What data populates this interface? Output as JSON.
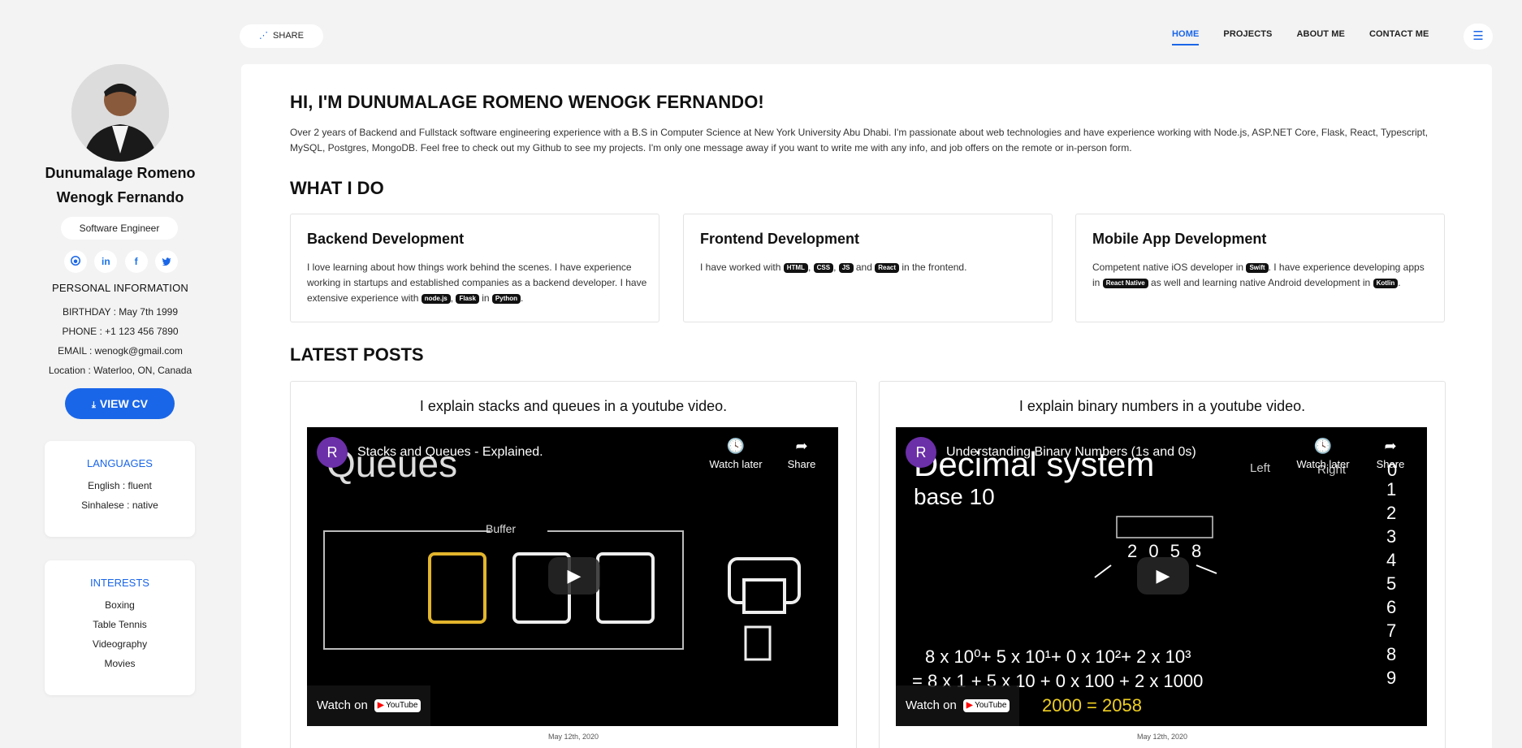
{
  "profile": {
    "name": "Dunumalage Romeno Wenogk Fernando",
    "role": "Software Engineer",
    "socials": [
      "github-icon",
      "linkedin-icon",
      "facebook-icon",
      "twitter-icon"
    ],
    "personal_title": "PERSONAL INFORMATION",
    "birthday": "BIRTHDAY : May 7th 1999",
    "phone": "PHONE : +1 123 456 7890",
    "email": "EMAIL : wenogk@gmail.com",
    "location": "Location : Waterloo, ON, Canada",
    "cv_label": "VIEW CV"
  },
  "languages": {
    "title": "LANGUAGES",
    "items": [
      "English : fluent",
      "Sinhalese : native"
    ]
  },
  "interests": {
    "title": "INTERESTS",
    "items": [
      "Boxing",
      "Table Tennis",
      "Videography",
      "Movies"
    ]
  },
  "topbar": {
    "share": "SHARE",
    "nav": [
      "HOME",
      "PROJECTS",
      "ABOUT ME",
      "CONTACT ME"
    ],
    "active": "HOME"
  },
  "hero": {
    "title": "HI, I'M DUNUMALAGE ROMENO WENOGK FERNANDO!",
    "text": "Over 2 years of Backend and Fullstack software engineering experience with a B.S in Computer Science at New York University Abu Dhabi. I'm passionate about web technologies and have experience working with Node.js, ASP.NET Core, Flask, React, Typescript, MySQL, Postgres, MongoDB. Feel free to check out my Github to see my projects. I'm only one message away if you want to write me with any info, and job offers on the remote or in-person form."
  },
  "what_i_do": {
    "title": "WHAT I DO",
    "services": [
      {
        "title": "Backend Development"
      },
      {
        "title": "Frontend Development"
      },
      {
        "title": "Mobile App Development"
      }
    ],
    "backend": {
      "t1": "I love learning about how things work behind the scenes. I have experience working in startups and established companies as a backend developer. I have extensive experience with ",
      "tags": [
        "node.js",
        "Flask",
        "Python"
      ],
      "sep": ", ",
      "in": " in ",
      "end": "."
    },
    "frontend": {
      "t1": "I have worked with ",
      "tags": [
        "HTML",
        "CSS",
        "JS",
        "React"
      ],
      "sep": ", ",
      "and": " and ",
      "end": " in the frontend."
    },
    "mobile": {
      "t1": "Competent native iOS developer in ",
      "t2": ". I have experience developing apps in ",
      "t3": " as well and learning native Android development in ",
      "tags": [
        "Swift",
        "React Native",
        "Kotlin"
      ],
      "end": "."
    }
  },
  "posts": {
    "title": "LATEST POSTS",
    "items": [
      {
        "heading": "I explain stacks and queues in a youtube video.",
        "video_title": "Stacks and Queues - Explained.",
        "channel_initial": "R",
        "date": "May 12th, 2020",
        "overlay_big": "Queues",
        "overlay_label": "Buffer"
      },
      {
        "heading": "I explain binary numbers in a youtube video.",
        "video_title": "Understanding Binary Numbers (1s and 0s)",
        "channel_initial": "R",
        "date": "May 12th, 2020",
        "overlay_big": "Decimal system",
        "overlay_sub": "base 10",
        "digits": [
          "1",
          "2",
          "3",
          "4",
          "5",
          "6",
          "7",
          "8",
          "9"
        ],
        "eq1": "8 x 10⁰+ 5 x 10¹+ 0 x 10²+ 2 x 10³",
        "eq2": "= 8 x 1 + 5 x 10 + 0 x 100 + 2 x 1000",
        "eq3": "2000 = 2058",
        "number": "2 0 5 8",
        "left_label": "Left",
        "right_label": "Right",
        "top_digit": "0"
      }
    ],
    "watch_later": "Watch later",
    "share": "Share",
    "watch_on": "Watch on",
    "youtube": "YouTube"
  }
}
